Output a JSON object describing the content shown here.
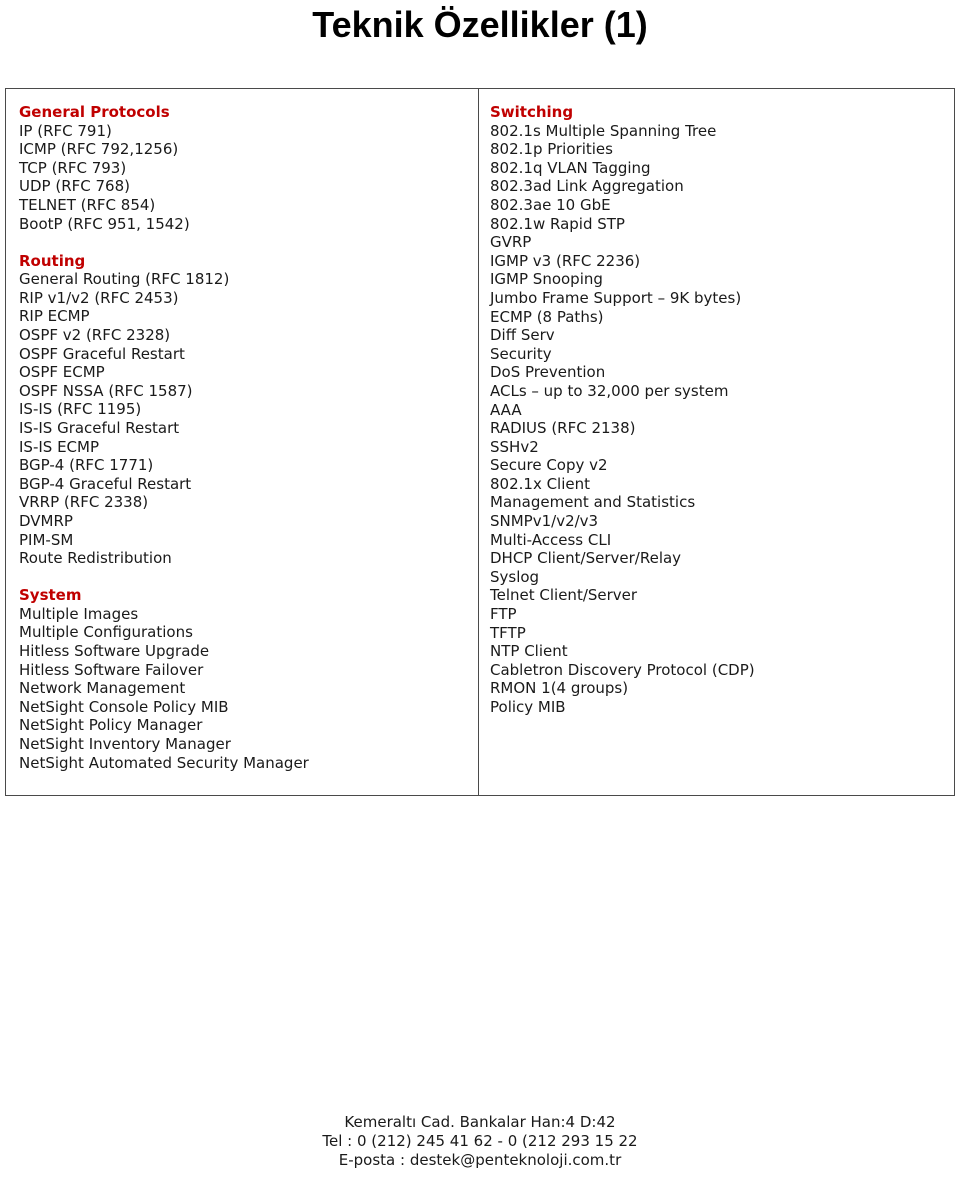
{
  "title": "Teknik Özellikler (1)",
  "colors": {
    "heading_red": "#C00000",
    "text": "#1a1a1a",
    "border": "#4a4a4a",
    "background": "#ffffff"
  },
  "table": {
    "left_column": {
      "sections": [
        {
          "heading": "General Protocols",
          "items": [
            "IP (RFC 791)",
            "ICMP (RFC 792,1256)",
            "TCP (RFC 793)",
            "UDP (RFC 768)",
            "TELNET (RFC 854)",
            "BootP (RFC 951, 1542)"
          ]
        },
        {
          "heading": "Routing",
          "items": [
            "General Routing (RFC 1812)",
            "RIP v1/v2 (RFC 2453)",
            "RIP ECMP",
            "OSPF v2 (RFC 2328)",
            "OSPF Graceful Restart",
            "OSPF ECMP",
            "OSPF NSSA (RFC 1587)",
            "IS-IS (RFC 1195)",
            "IS-IS Graceful Restart",
            "IS-IS ECMP",
            "BGP-4 (RFC 1771)",
            "BGP-4 Graceful Restart",
            "VRRP (RFC 2338)",
            "DVMRP",
            "PIM-SM",
            "Route Redistribution"
          ]
        },
        {
          "heading": "System",
          "items": [
            "Multiple Images",
            "Multiple Configurations",
            "Hitless Software Upgrade",
            "Hitless Software Failover",
            "Network Management",
            "NetSight Console Policy MIB",
            "NetSight Policy Manager",
            "NetSight Inventory Manager",
            "NetSight Automated Security Manager"
          ]
        }
      ]
    },
    "right_column": {
      "sections": [
        {
          "heading": "Switching",
          "items": [
            "802.1s Multiple Spanning Tree",
            "802.1p Priorities",
            "802.1q VLAN Tagging",
            "802.3ad Link Aggregation",
            "802.3ae 10 GbE",
            "802.1w Rapid STP",
            "GVRP",
            "IGMP v3 (RFC 2236)",
            "IGMP Snooping",
            "Jumbo Frame Support – 9K bytes)",
            "ECMP (8 Paths)",
            "Diff Serv",
            "Security",
            "DoS Prevention",
            "ACLs – up to 32,000 per system",
            "AAA",
            "RADIUS (RFC 2138)",
            "SSHv2",
            "Secure Copy v2",
            "802.1x Client",
            "Management and Statistics",
            "SNMPv1/v2/v3",
            "Multi-Access CLI",
            "DHCP Client/Server/Relay",
            "Syslog",
            "Telnet Client/Server",
            "FTP",
            "TFTP",
            "NTP Client",
            "Cabletron Discovery Protocol (CDP)",
            "RMON 1(4 groups)",
            "Policy MIB"
          ]
        }
      ]
    }
  },
  "footer": {
    "lines": [
      "Kemeraltı Cad. Bankalar Han:4 D:42",
      "Tel : 0 (212) 245 41 62 - 0 (212 293 15 22",
      "E-posta : destek@penteknoloji.com.tr"
    ]
  }
}
